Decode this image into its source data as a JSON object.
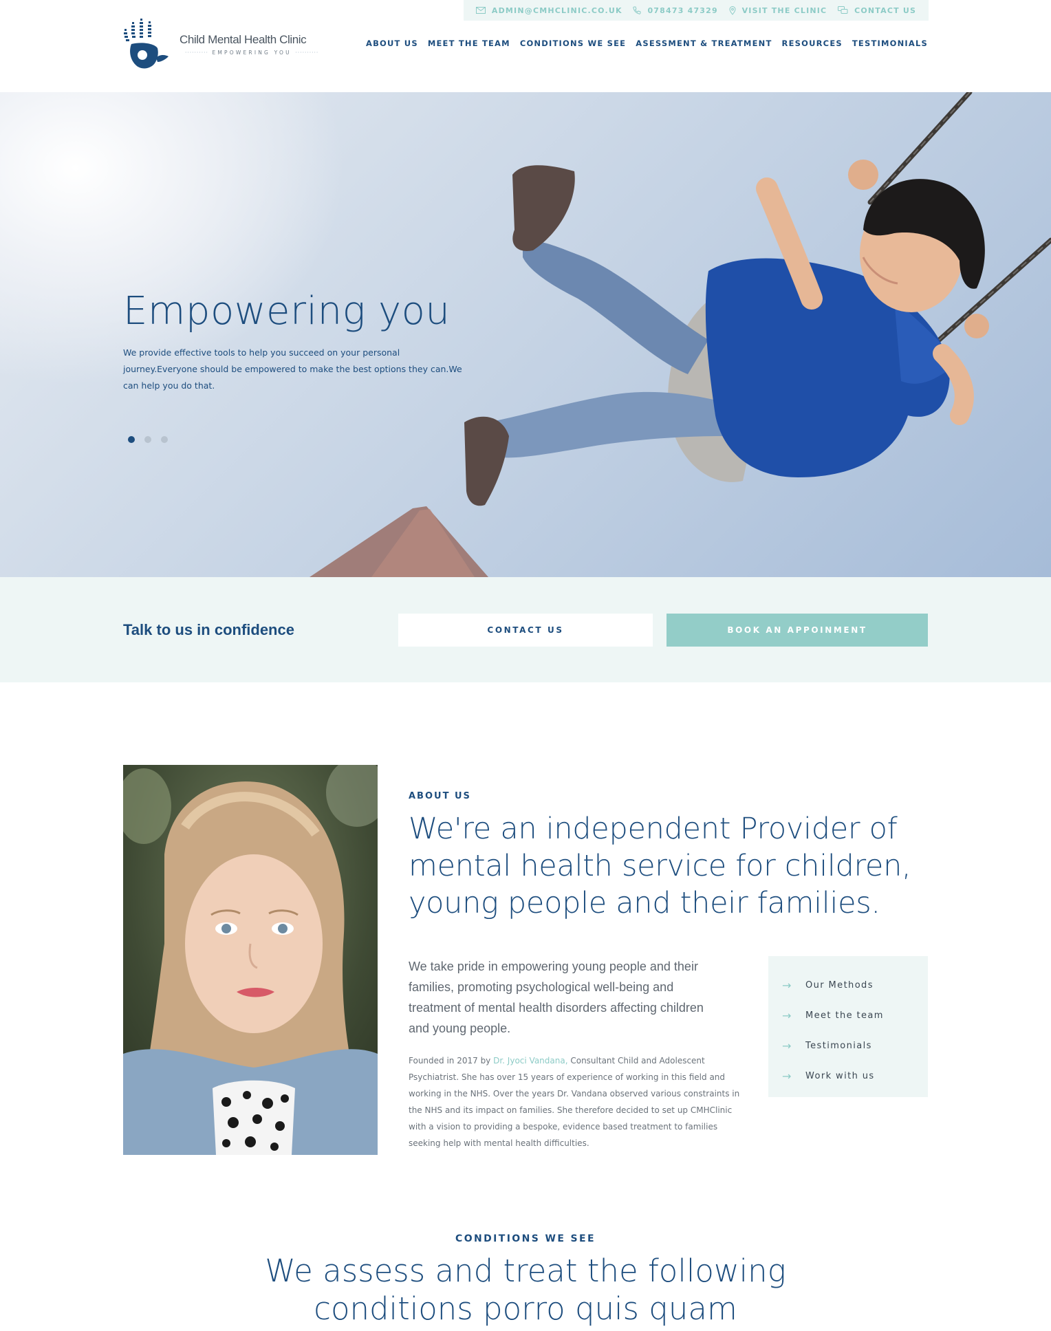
{
  "brand": {
    "name": "Child Mental Health Clinic",
    "tagline": "EMPOWERING YOU",
    "accent": "#8ccbc6",
    "primary": "#1d4d7e"
  },
  "topbar": {
    "email": "ADMIN@CMHCLINIC.CO.UK",
    "phone": "078473 47329",
    "visit": "VISIT THE CLINIC",
    "contact": "CONTACT US"
  },
  "nav": {
    "items": [
      "ABOUT US",
      "MEET THE TEAM",
      "CONDITIONS WE SEE",
      "ASESSMENT & TREATMENT",
      "RESOURCES",
      "TESTIMONIALS"
    ]
  },
  "hero": {
    "title": "Empowering you",
    "body": "We provide effective tools to help you succeed on your personal journey.Everyone should be empowered to make the best options they can.We can help you do that.",
    "slide_count": 3,
    "active_slide": 1
  },
  "cta": {
    "title": "Talk to us in confidence",
    "contact_label": "CONTACT US",
    "book_label": "BOOK AN APPOINMENT"
  },
  "about": {
    "label": "ABOUT US",
    "heading": "We're an independent Provider of mental health service for children, young people and their families.",
    "lead": "We take pride in empowering young people and their families, promoting psychological well-being and treatment of mental health disorders affecting children and young people.",
    "small_prefix": "Founded in 2017 by ",
    "small_link": "Dr. Jyoci Vandana,",
    "small_suffix": " Consultant Child and Adolescent Psychiatrist. She has over 15 years of experience of working in this field and working in the NHS. Over the years Dr. Vandana observed various constraints in the NHS and its impact on families. She therefore decided to set up CMHClinic with a vision to providing a bespoke, evidence based treatment to families seeking help with mental health difficulties.",
    "side_links": [
      "Our Methods",
      "Meet the team",
      "Testimonials",
      "Work with us"
    ]
  },
  "conditions": {
    "label": "CONDITIONS WE SEE",
    "heading_line1": "We assess and treat the following",
    "heading_line2": "conditions porro quis quam"
  }
}
